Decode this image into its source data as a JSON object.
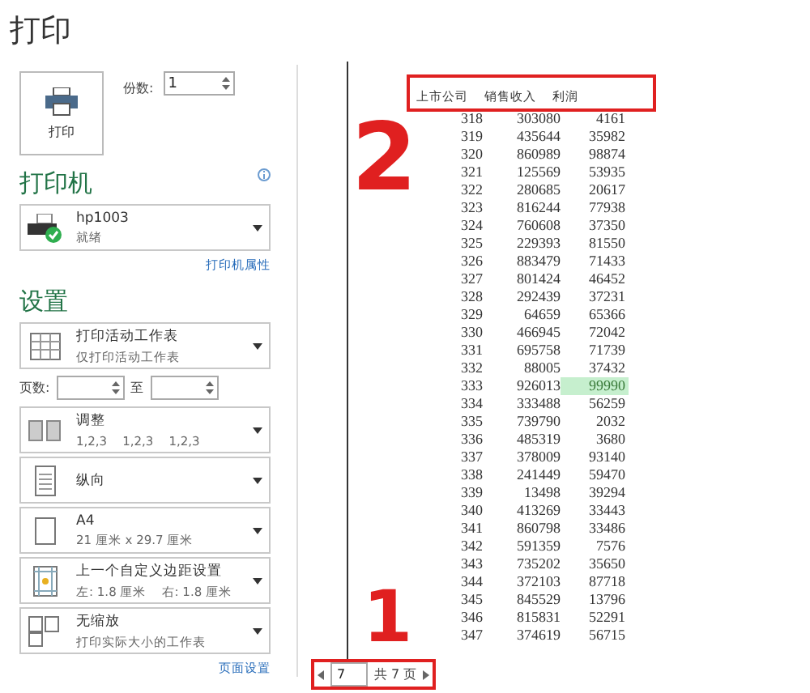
{
  "title": "打印",
  "print_button": {
    "label": "打印"
  },
  "copies": {
    "label": "份数:",
    "value": "1"
  },
  "printer": {
    "heading": "打印机",
    "name": "hp1003",
    "status": "就绪",
    "properties_link": "打印机属性"
  },
  "settings": {
    "heading": "设置",
    "dropdowns_before_pages": [
      {
        "kind": "sheet",
        "title": "打印活动工作表",
        "subtitle": "仅打印活动工作表"
      }
    ],
    "pages": {
      "label": "页数:",
      "to_label": "至"
    },
    "dropdowns": [
      {
        "kind": "collate",
        "title": "调整",
        "subtitle": "1,2,3    1,2,3    1,2,3"
      },
      {
        "kind": "portrait",
        "title": "纵向"
      },
      {
        "kind": "paper",
        "title": "A4",
        "subtitle": "21 厘米 x 29.7 厘米"
      },
      {
        "kind": "margins",
        "title": "上一个自定义边距设置",
        "subtitle": "左: 1.8 厘米    右: 1.8 厘米"
      },
      {
        "kind": "scale",
        "title": "无缩放",
        "subtitle": "打印实际大小的工作表"
      }
    ],
    "page_setup_link": "页面设置"
  },
  "preview": {
    "columns": [
      "上市公司",
      "销售收入",
      "利润"
    ],
    "rows": [
      {
        "cells": [
          "318",
          "303080",
          "4161"
        ],
        "highlighted": false
      },
      {
        "cells": [
          "319",
          "435644",
          "35982"
        ],
        "highlighted": false
      },
      {
        "cells": [
          "320",
          "860989",
          "98874"
        ],
        "highlighted": false
      },
      {
        "cells": [
          "321",
          "125569",
          "53935"
        ],
        "highlighted": false
      },
      {
        "cells": [
          "322",
          "280685",
          "20617"
        ],
        "highlighted": false
      },
      {
        "cells": [
          "323",
          "816244",
          "77938"
        ],
        "highlighted": false
      },
      {
        "cells": [
          "324",
          "760608",
          "37350"
        ],
        "highlighted": false
      },
      {
        "cells": [
          "325",
          "229393",
          "81550"
        ],
        "highlighted": false
      },
      {
        "cells": [
          "326",
          "883479",
          "71433"
        ],
        "highlighted": false
      },
      {
        "cells": [
          "327",
          "801424",
          "46452"
        ],
        "highlighted": false
      },
      {
        "cells": [
          "328",
          "292439",
          "37231"
        ],
        "highlighted": false
      },
      {
        "cells": [
          "329",
          "64659",
          "65366"
        ],
        "highlighted": false
      },
      {
        "cells": [
          "330",
          "466945",
          "72042"
        ],
        "highlighted": false
      },
      {
        "cells": [
          "331",
          "695758",
          "71739"
        ],
        "highlighted": false
      },
      {
        "cells": [
          "332",
          "88005",
          "37432"
        ],
        "highlighted": false
      },
      {
        "cells": [
          "333",
          "926013",
          "99990"
        ],
        "highlighted": true
      },
      {
        "cells": [
          "334",
          "333488",
          "56259"
        ],
        "highlighted": false
      },
      {
        "cells": [
          "335",
          "739790",
          "2032"
        ],
        "highlighted": false
      },
      {
        "cells": [
          "336",
          "485319",
          "3680"
        ],
        "highlighted": false
      },
      {
        "cells": [
          "337",
          "378009",
          "93140"
        ],
        "highlighted": false
      },
      {
        "cells": [
          "338",
          "241449",
          "59470"
        ],
        "highlighted": false
      },
      {
        "cells": [
          "339",
          "13498",
          "39294"
        ],
        "highlighted": false
      },
      {
        "cells": [
          "340",
          "413269",
          "33443"
        ],
        "highlighted": false
      },
      {
        "cells": [
          "341",
          "860798",
          "33486"
        ],
        "highlighted": false
      },
      {
        "cells": [
          "342",
          "591359",
          "7576"
        ],
        "highlighted": false
      },
      {
        "cells": [
          "343",
          "735202",
          "35650"
        ],
        "highlighted": false
      },
      {
        "cells": [
          "344",
          "372103",
          "87718"
        ],
        "highlighted": false
      },
      {
        "cells": [
          "345",
          "845529",
          "13796"
        ],
        "highlighted": false
      },
      {
        "cells": [
          "346",
          "815831",
          "52291"
        ],
        "highlighted": false
      },
      {
        "cells": [
          "347",
          "374619",
          "56715"
        ],
        "highlighted": false
      }
    ]
  },
  "pager": {
    "current": "7",
    "total_text": "共 7 页"
  },
  "annotations": [
    {
      "text": "2"
    },
    {
      "text": "1"
    }
  ]
}
